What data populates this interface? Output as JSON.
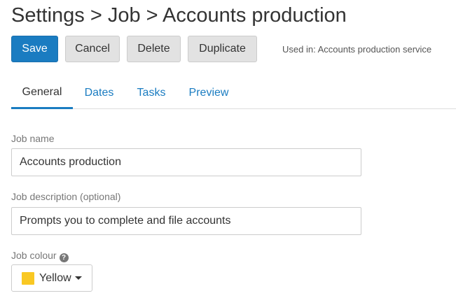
{
  "header": {
    "title": "Settings > Job > Accounts production"
  },
  "toolbar": {
    "save_label": "Save",
    "cancel_label": "Cancel",
    "delete_label": "Delete",
    "duplicate_label": "Duplicate",
    "used_in": "Used in: Accounts production service"
  },
  "tabs": [
    {
      "label": "General",
      "active": true
    },
    {
      "label": "Dates",
      "active": false
    },
    {
      "label": "Tasks",
      "active": false
    },
    {
      "label": "Preview",
      "active": false
    }
  ],
  "form": {
    "job_name": {
      "label": "Job name",
      "value": "Accounts production"
    },
    "job_description": {
      "label": "Job description (optional)",
      "value": "Prompts you to complete and file accounts"
    },
    "job_colour": {
      "label": "Job colour",
      "help_glyph": "?",
      "value": "Yellow",
      "swatch_color": "#f9c823"
    }
  },
  "colors": {
    "primary": "#1a7cc1",
    "button_default": "#e2e2e2"
  }
}
